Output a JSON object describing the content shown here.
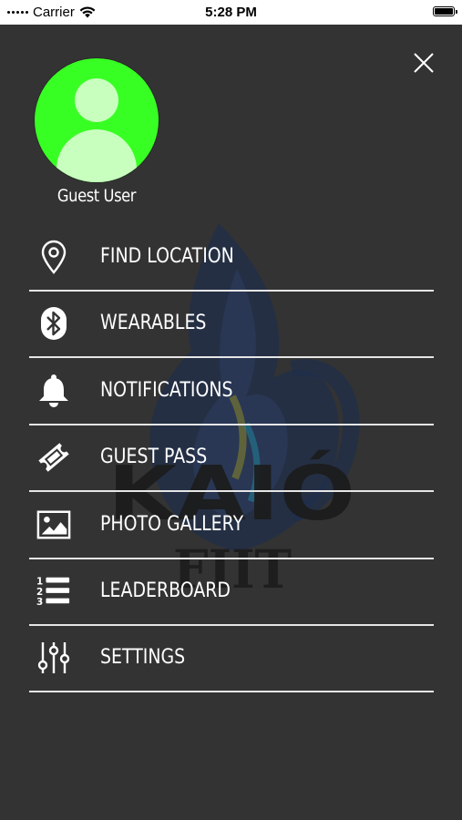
{
  "status_bar": {
    "carrier": "Carrier",
    "time": "5:28 PM"
  },
  "profile": {
    "name": "Guest User"
  },
  "watermark": {
    "line1": "KAIÓ",
    "line2": "FIIT"
  },
  "menu": [
    {
      "label": "FIND LOCATION",
      "icon": "location-pin-icon"
    },
    {
      "label": "WEARABLES",
      "icon": "bluetooth-icon"
    },
    {
      "label": "NOTIFICATIONS",
      "icon": "bell-icon"
    },
    {
      "label": "GUEST PASS",
      "icon": "ticket-icon"
    },
    {
      "label": "PHOTO GALLERY",
      "icon": "image-icon"
    },
    {
      "label": "LEADERBOARD",
      "icon": "ranked-list-icon"
    },
    {
      "label": "SETTINGS",
      "icon": "sliders-icon"
    }
  ],
  "colors": {
    "background": "#333333",
    "avatar": "#38ff23",
    "text": "#ffffff",
    "divider": "#e6e6e6"
  }
}
